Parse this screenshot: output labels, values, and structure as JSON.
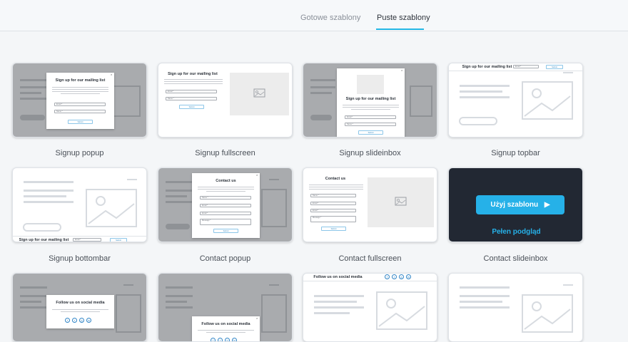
{
  "tabs": [
    {
      "label": "Gotowe szablony",
      "active": false
    },
    {
      "label": "Puste szablony",
      "active": true
    }
  ],
  "accent": "#23b7e5",
  "cards": {
    "signup_popup": {
      "label": "Signup popup"
    },
    "signup_fullscreen": {
      "label": "Signup fullscreen"
    },
    "signup_slideinbox": {
      "label": "Signup slideinbox"
    },
    "signup_topbar": {
      "label": "Signup topbar"
    },
    "signup_bottombar": {
      "label": "Signup bottombar"
    },
    "contact_popup": {
      "label": "Contact popup"
    },
    "contact_fullscreen": {
      "label": "Contact fullscreen"
    },
    "contact_slideinbox": {
      "label": "Contact slideinbox",
      "use_button": "Użyj szablonu",
      "preview_link": "Pełen podgląd"
    }
  },
  "mini": {
    "signup_title": "Sign up for our mailing list",
    "contact_title": "Contact us",
    "social_title": "Follow us on social media",
    "email_field": "Email *",
    "name_field": "Name *",
    "message_field": "Message *",
    "button": "Submit",
    "close": "×",
    "social_icons": [
      "f",
      "t",
      "◎",
      "in"
    ]
  }
}
